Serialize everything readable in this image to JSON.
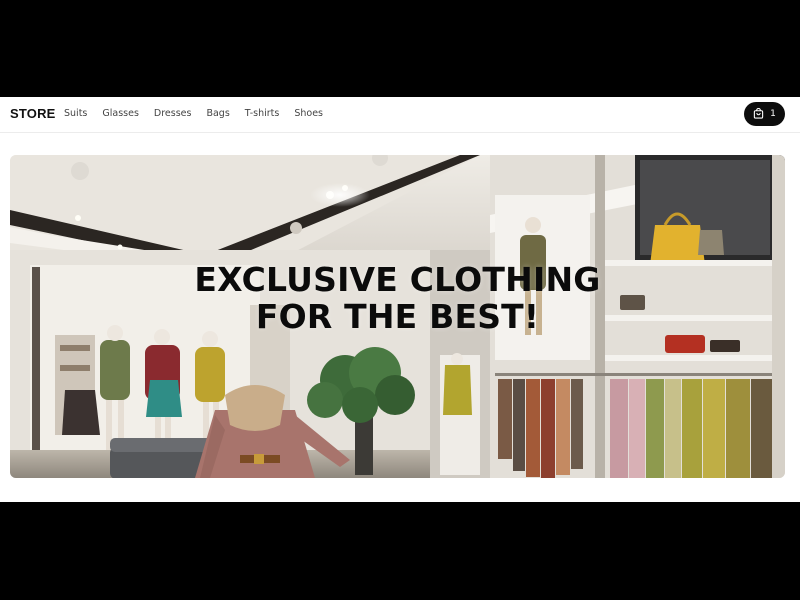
{
  "brand": {
    "logo": "STORE"
  },
  "nav": {
    "links": [
      "Suits",
      "Glasses",
      "Dresses",
      "Bags",
      "T-shirts",
      "Shoes"
    ]
  },
  "cart": {
    "count": "1",
    "icon": "shopping-bag-icon"
  },
  "hero": {
    "title": "EXCLUSIVE CLOTHING FOR THE BEST!",
    "image_alt_subject": "luxury clothing store interior"
  },
  "colors": {
    "page_bg": "#ffffff",
    "letterbox": "#000000",
    "cart_bg": "#0d0d0d",
    "text": "#111111"
  }
}
